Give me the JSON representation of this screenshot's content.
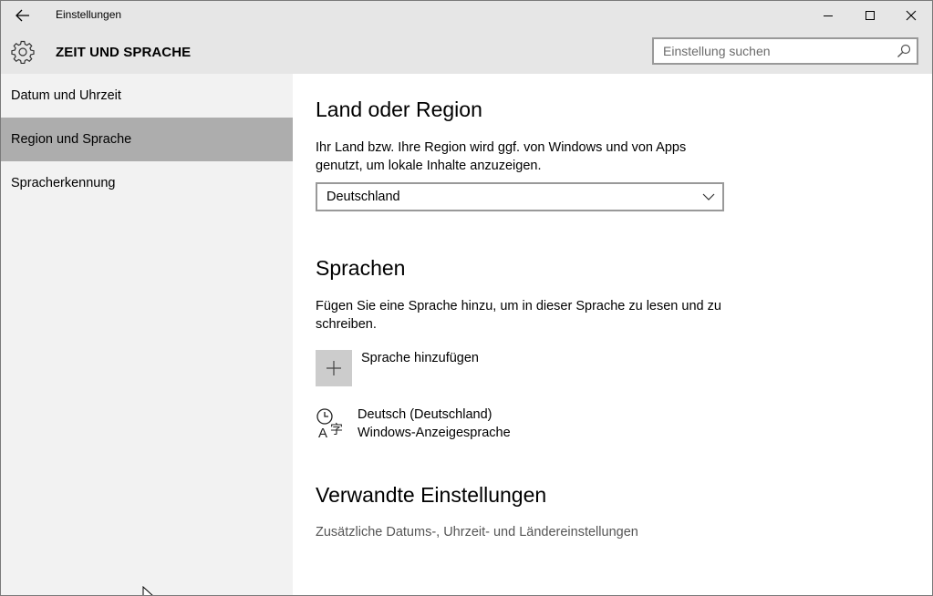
{
  "titlebar": {
    "title": "Einstellungen",
    "back_icon": "arrow-left-icon",
    "minimize_icon": "minimize-icon",
    "maximize_icon": "maximize-icon",
    "close_icon": "close-icon"
  },
  "header": {
    "section_title": "ZEIT UND SPRACHE",
    "icon": "gear-icon",
    "search": {
      "placeholder": "Einstellung suchen",
      "value": ""
    }
  },
  "sidebar": {
    "items": [
      {
        "label": "Datum und Uhrzeit",
        "selected": false
      },
      {
        "label": "Region und Sprache",
        "selected": true
      },
      {
        "label": "Spracherkennung",
        "selected": false
      }
    ]
  },
  "main": {
    "region": {
      "heading": "Land oder Region",
      "description_line1": "Ihr Land bzw. Ihre Region wird ggf. von Windows und von Apps",
      "description_line2": "genutzt, um lokale Inhalte anzuzeigen.",
      "selected_country": "Deutschland"
    },
    "languages": {
      "heading": "Sprachen",
      "description_line1": "Fügen Sie eine Sprache hinzu, um in dieser Sprache zu lesen und zu",
      "description_line2": "schreiben.",
      "add_label": "Sprache hinzufügen",
      "items": [
        {
          "name": "Deutsch (Deutschland)",
          "subtitle": "Windows-Anzeigesprache",
          "icon": "language-time-icon"
        }
      ]
    },
    "related": {
      "heading": "Verwandte Einstellungen",
      "link": "Zusätzliche Datums-, Uhrzeit- und Ländereinstellungen"
    }
  },
  "colors": {
    "chrome": "#e6e6e6",
    "sidebar": "#f2f2f2",
    "selected": "#adadad",
    "add_button": "#cccccc"
  }
}
